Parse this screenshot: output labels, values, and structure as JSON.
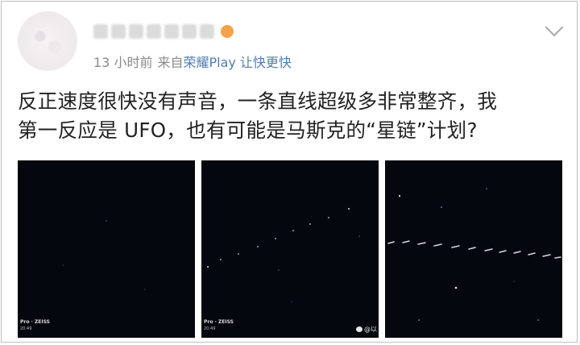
{
  "post": {
    "username": "",
    "meta": {
      "time": "13 小时前",
      "from_prefix": "来自",
      "source": "荣耀Play 让快更快"
    },
    "text_lines": [
      "反正速度很快没有声音，一条直线超级多非常整齐，我",
      "第一反应是 UFO，也有可能是马斯克的“星链”计划?"
    ]
  },
  "icons": {
    "avatar": "avatar-icon",
    "dropdown": "chevron-down-icon",
    "weibo_watermark": "weibo-logo-icon"
  },
  "photos": [
    {
      "camera_label": "Pro · ZEISS",
      "time_label": "20:49",
      "watermark": ""
    },
    {
      "camera_label": "Pro · ZEISS",
      "time_label": "20:49",
      "watermark": "@以"
    },
    {
      "camera_label": "",
      "time_label": "",
      "watermark": ""
    }
  ]
}
